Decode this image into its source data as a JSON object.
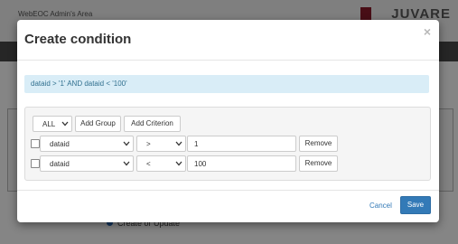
{
  "background": {
    "app_title": "WebEOC Admin's Area",
    "logo_text": "JUVARE",
    "radio_label": "Create or Update"
  },
  "modal": {
    "title": "Create condition",
    "close_icon": "×",
    "query_text": "dataid > '1' AND dataid < '100'",
    "builder": {
      "group_operator": "ALL",
      "add_group_label": "Add Group",
      "add_criterion_label": "Add Criterion",
      "rows": [
        {
          "field": "dataid",
          "operator": ">",
          "value": "1",
          "remove_label": "Remove"
        },
        {
          "field": "dataid",
          "operator": "<",
          "value": "100",
          "remove_label": "Remove"
        }
      ]
    },
    "footer": {
      "cancel_label": "Cancel",
      "save_label": "Save"
    }
  },
  "colors": {
    "primary": "#337ab7",
    "info_bg": "#d9edf7",
    "info_text": "#31708f",
    "brand": "#8a1c2b"
  }
}
